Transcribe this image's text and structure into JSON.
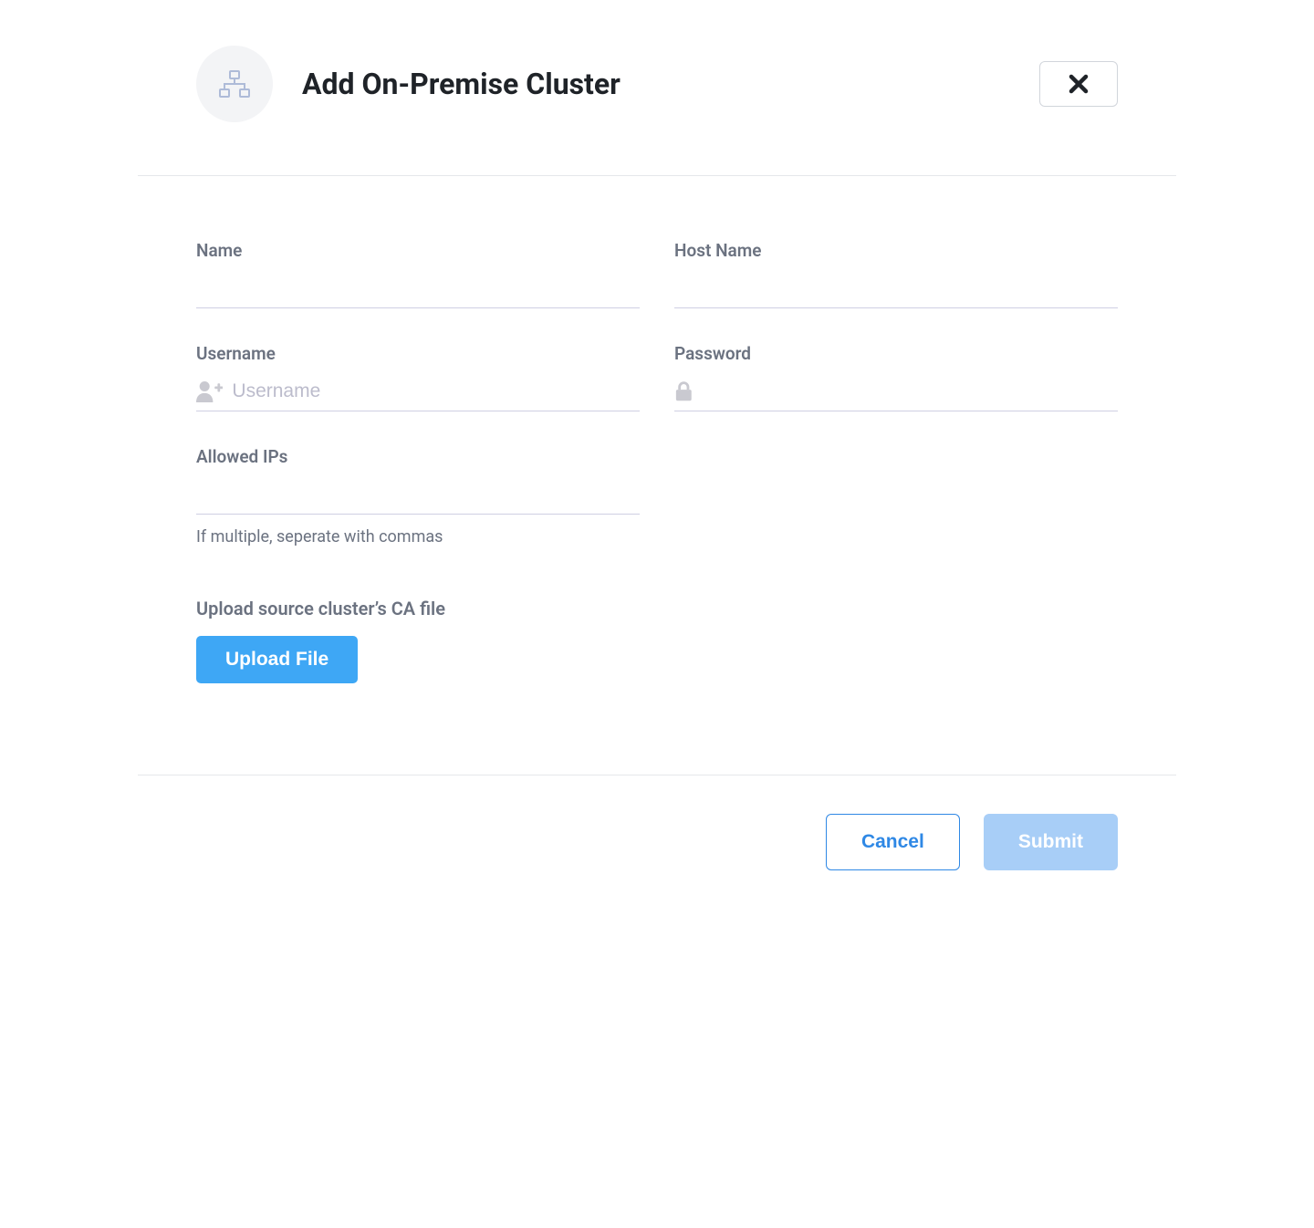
{
  "header": {
    "title": "Add On-Premise Cluster"
  },
  "fields": {
    "name": {
      "label": "Name",
      "value": "",
      "placeholder": ""
    },
    "hostname": {
      "label": "Host Name",
      "value": "",
      "placeholder": ""
    },
    "username": {
      "label": "Username",
      "value": "",
      "placeholder": "Username"
    },
    "password": {
      "label": "Password",
      "value": "",
      "placeholder": ""
    },
    "allowed_ips": {
      "label": "Allowed IPs",
      "value": "",
      "placeholder": "",
      "helper": "If multiple, seperate with commas"
    }
  },
  "upload": {
    "section_label": "Upload source cluster’s CA file",
    "button_label": "Upload File"
  },
  "footer": {
    "cancel": "Cancel",
    "submit": "Submit"
  }
}
